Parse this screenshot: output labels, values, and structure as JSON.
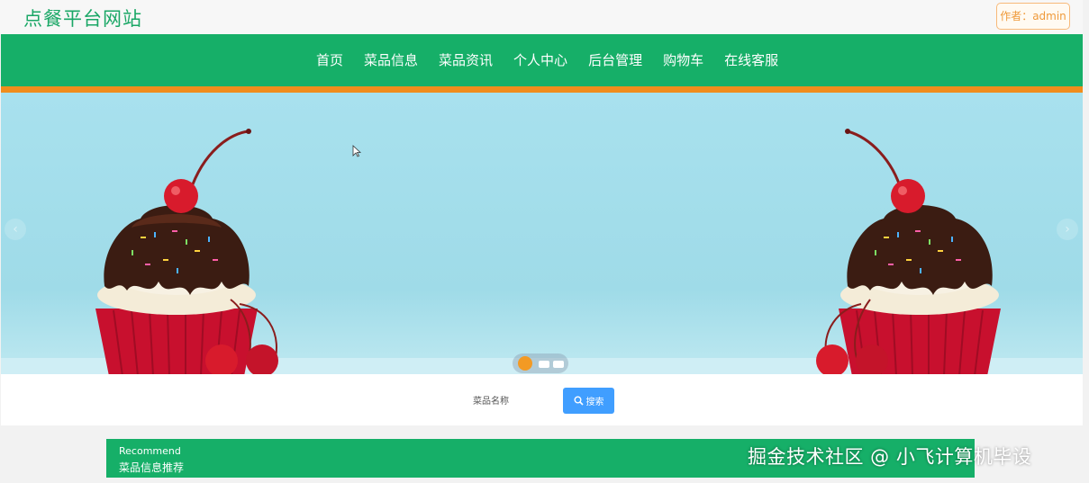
{
  "header": {
    "site_title": "点餐平台网站",
    "author_label": "作者：admin"
  },
  "nav": {
    "items": [
      "首页",
      "菜品信息",
      "菜品资讯",
      "个人中心",
      "后台管理",
      "购物车",
      "在线客服"
    ]
  },
  "banner": {
    "slides_total": 3,
    "active_slide": 1,
    "prev_icon": "chevron-left-icon",
    "next_icon": "chevron-right-icon"
  },
  "search": {
    "field_label": "菜品名称",
    "button_label": "搜索",
    "button_icon": "search-icon"
  },
  "recommend": {
    "title_en": "Recommend",
    "title_cn": "菜品信息推荐"
  },
  "watermark": "掘金技术社区 @ 小飞计算机毕设",
  "colors": {
    "primary": "#16af68",
    "accent": "#f08d1c",
    "button": "#409eff",
    "title": "#1aa766"
  }
}
